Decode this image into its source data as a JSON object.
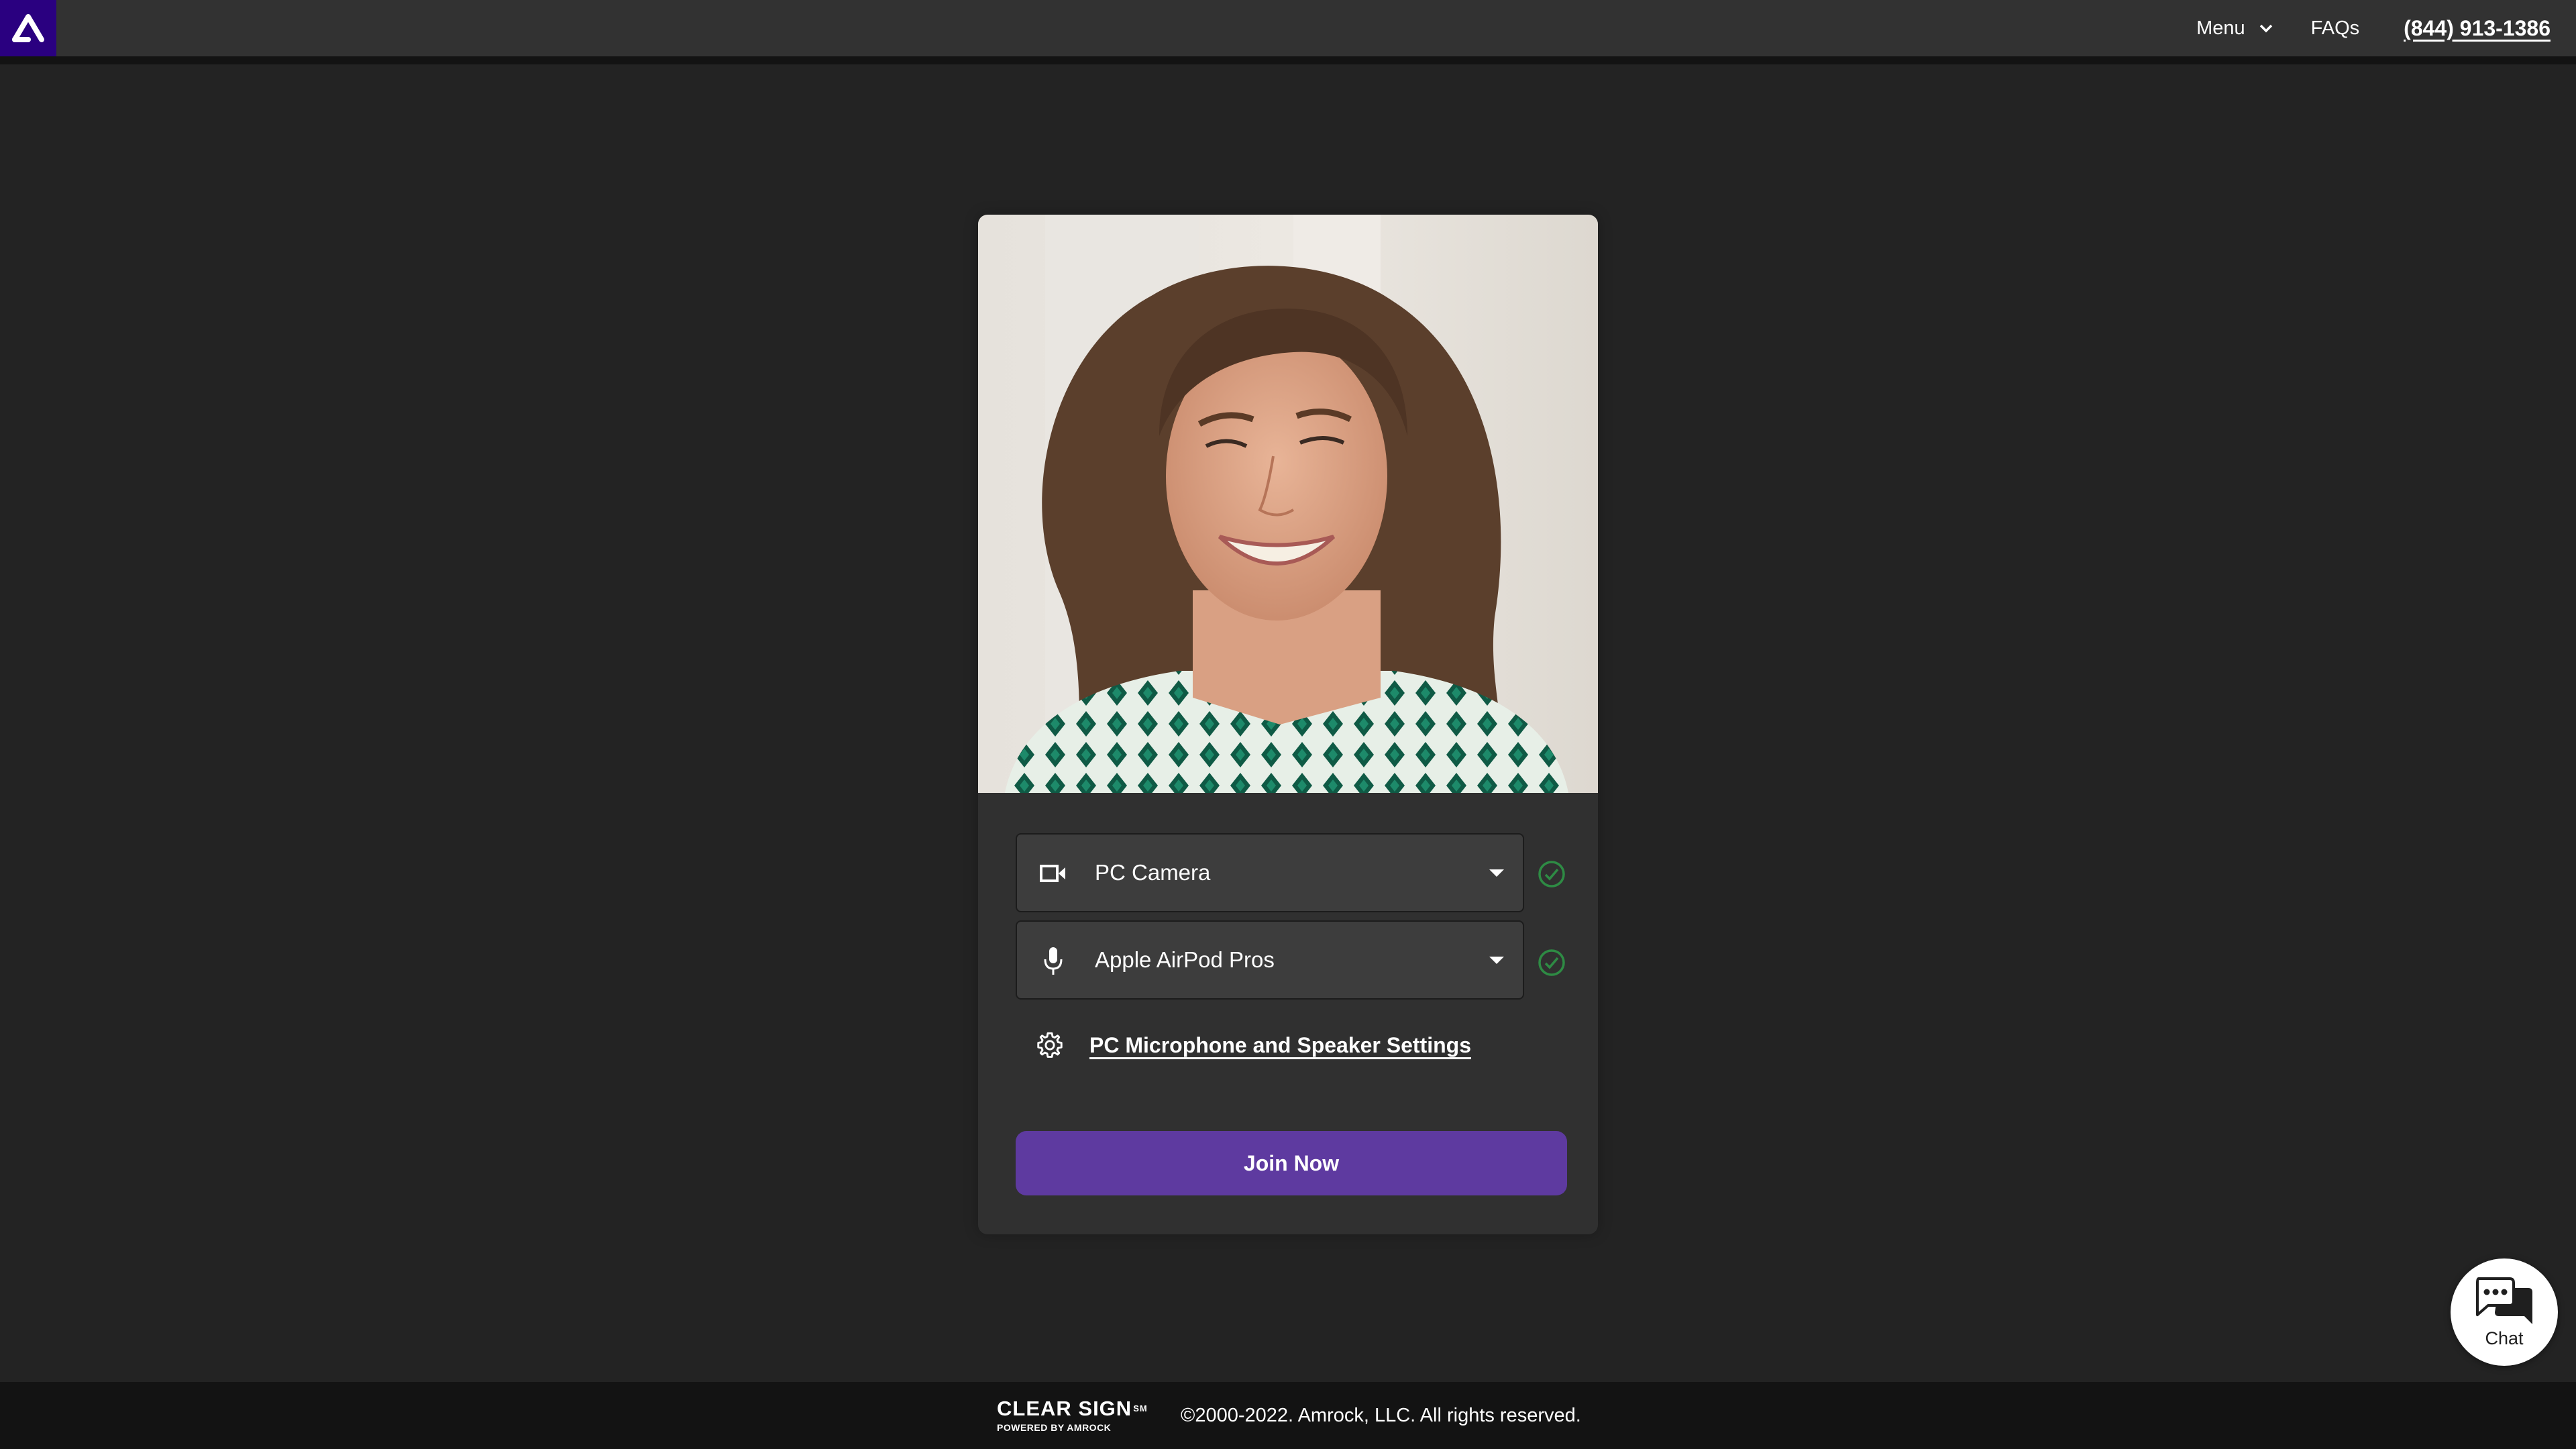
{
  "header": {
    "logo_name": "Amrock logo",
    "nav": {
      "menu_label": "Menu",
      "faqs_label": "FAQs",
      "phone_label": "(844) 913-1386"
    }
  },
  "card": {
    "preview_alt": "Camera preview of smiling woman",
    "camera_select": {
      "value": "PC Camera",
      "status": "ok"
    },
    "microphone_select": {
      "value": "Apple AirPod Pros",
      "status": "ok"
    },
    "settings_link": "PC Microphone and Speaker Settings",
    "join_button": "Join Now"
  },
  "footer": {
    "brand_name": "CLEAR SIGN",
    "brand_mark": "SM",
    "powered_by": "POWERED BY AMROCK",
    "copyright": "©2000-2022. Amrock, LLC. All rights reserved."
  },
  "chat": {
    "label": "Chat"
  },
  "colors": {
    "brand_purple": "#2a0080",
    "join_button": "#5e3aa0",
    "status_ok": "#2e8b44",
    "page_bg": "#232323",
    "header_bg": "#323232",
    "card_bg": "#303030"
  }
}
